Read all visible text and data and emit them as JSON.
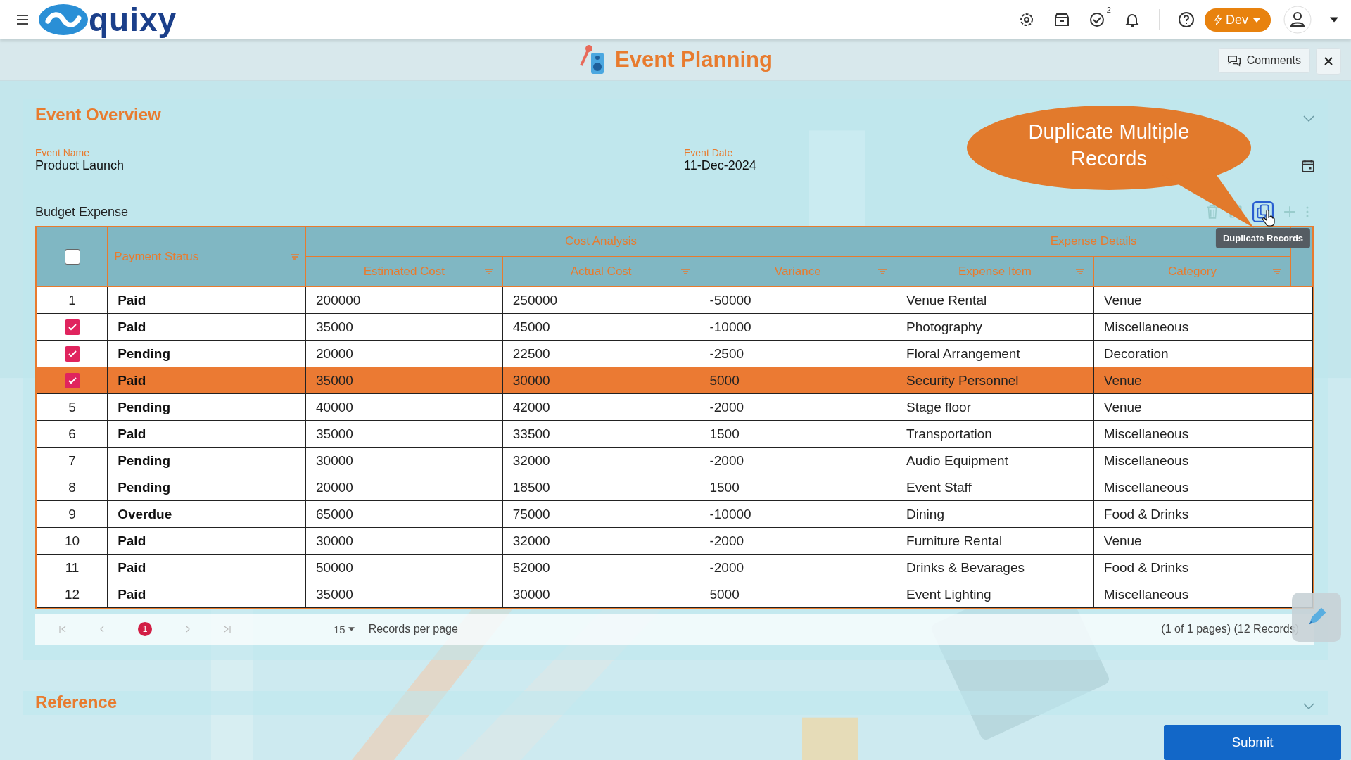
{
  "header": {
    "logo": "quixy",
    "tasks_badge": "2",
    "env_button": "Dev"
  },
  "page": {
    "title": "Event Planning",
    "comments_button": "Comments"
  },
  "overview": {
    "title": "Event Overview",
    "expanded": true,
    "fields": [
      {
        "label": "Event Name",
        "value": "Product Launch",
        "kind": "text"
      },
      {
        "label": "Event Date",
        "value": "11-Dec-2024",
        "kind": "date"
      }
    ]
  },
  "callout": "Duplicate Multiple Records",
  "grid": {
    "label": "Budget Expense",
    "tooltip": "Duplicate Records",
    "all_selected": false,
    "status_column": "Payment Status",
    "groups": [
      {
        "label": "Cost Analysis",
        "columns": [
          "Estimated Cost",
          "Actual Cost",
          "Variance"
        ]
      },
      {
        "label": "Expense Details",
        "columns": [
          "Expense Item",
          "Category"
        ]
      }
    ],
    "rows": [
      {
        "number": "1",
        "selected": false,
        "highlighted": false,
        "payment_status": "Paid",
        "cells": [
          "200000",
          "250000",
          "-50000",
          "Venue Rental",
          "Venue"
        ]
      },
      {
        "selected": true,
        "highlighted": false,
        "payment_status": "Paid",
        "cells": [
          "35000",
          "45000",
          "-10000",
          "Photography",
          "Miscellaneous"
        ]
      },
      {
        "selected": true,
        "highlighted": false,
        "payment_status": "Pending",
        "cells": [
          "20000",
          "22500",
          "-2500",
          "Floral Arrangement",
          "Decoration"
        ]
      },
      {
        "selected": true,
        "highlighted": true,
        "payment_status": "Paid",
        "cells": [
          "35000",
          "30000",
          "5000",
          "Security Personnel",
          "Venue"
        ]
      },
      {
        "number": "5",
        "selected": false,
        "highlighted": false,
        "payment_status": "Pending",
        "cells": [
          "40000",
          "42000",
          "-2000",
          "Stage floor",
          "Venue"
        ]
      },
      {
        "number": "6",
        "selected": false,
        "highlighted": false,
        "payment_status": "Paid",
        "cells": [
          "35000",
          "33500",
          "1500",
          "Transportation",
          "Miscellaneous"
        ]
      },
      {
        "number": "7",
        "selected": false,
        "highlighted": false,
        "payment_status": "Pending",
        "cells": [
          "30000",
          "32000",
          "-2000",
          "Audio Equipment",
          "Miscellaneous"
        ]
      },
      {
        "number": "8",
        "selected": false,
        "highlighted": false,
        "payment_status": "Pending",
        "cells": [
          "20000",
          "18500",
          "1500",
          "Event Staff",
          "Miscellaneous"
        ]
      },
      {
        "number": "9",
        "selected": false,
        "highlighted": false,
        "payment_status": "Overdue",
        "cells": [
          "65000",
          "75000",
          "-10000",
          "Dining",
          "Food & Drinks"
        ]
      },
      {
        "number": "10",
        "selected": false,
        "highlighted": false,
        "payment_status": "Paid",
        "cells": [
          "30000",
          "32000",
          "-2000",
          "Furniture Rental",
          "Venue"
        ]
      },
      {
        "number": "11",
        "selected": false,
        "highlighted": false,
        "payment_status": "Paid",
        "cells": [
          "50000",
          "52000",
          "-2000",
          "Drinks & Bevarages",
          "Food & Drinks"
        ]
      },
      {
        "number": "12",
        "selected": false,
        "highlighted": false,
        "payment_status": "Paid",
        "cells": [
          "35000",
          "30000",
          "5000",
          "Event Lighting",
          "Miscellaneous"
        ]
      }
    ],
    "pagination": {
      "current_page": "1",
      "page_size": "15",
      "per_page_label": "Records per page",
      "summary": "(1 of 1 pages) (12 Records)"
    }
  },
  "reference": {
    "title": "Reference",
    "expanded": false
  },
  "submit_button": "Submit"
}
